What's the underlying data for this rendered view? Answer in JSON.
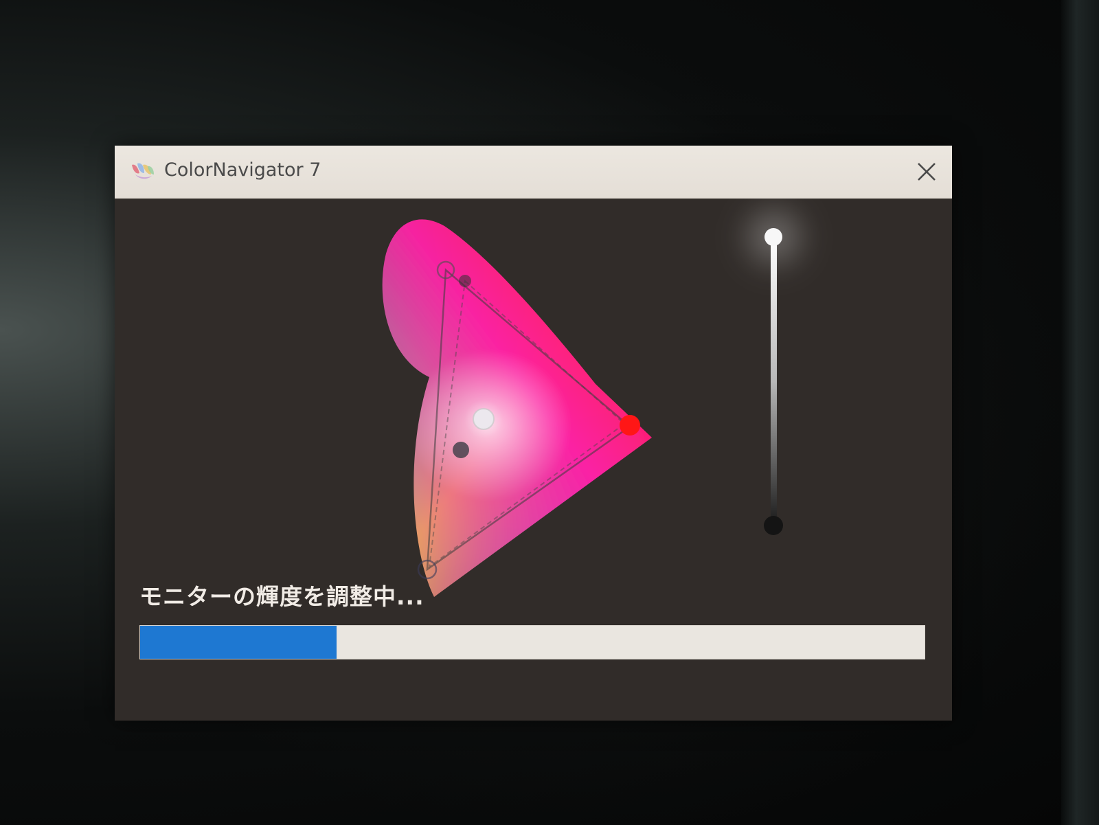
{
  "window": {
    "title": "ColorNavigator 7",
    "icons": {
      "app": "colornavigator-app-icon",
      "close": "close-icon"
    }
  },
  "main": {
    "status_text": "モニターの輝度を調整中...",
    "progress": 0.25
  },
  "colors": {
    "progress_fill": "#1e78d2",
    "progress_track": "#eae6e0",
    "window_background": "#312c29",
    "titlebar": "#e8e3dc"
  }
}
